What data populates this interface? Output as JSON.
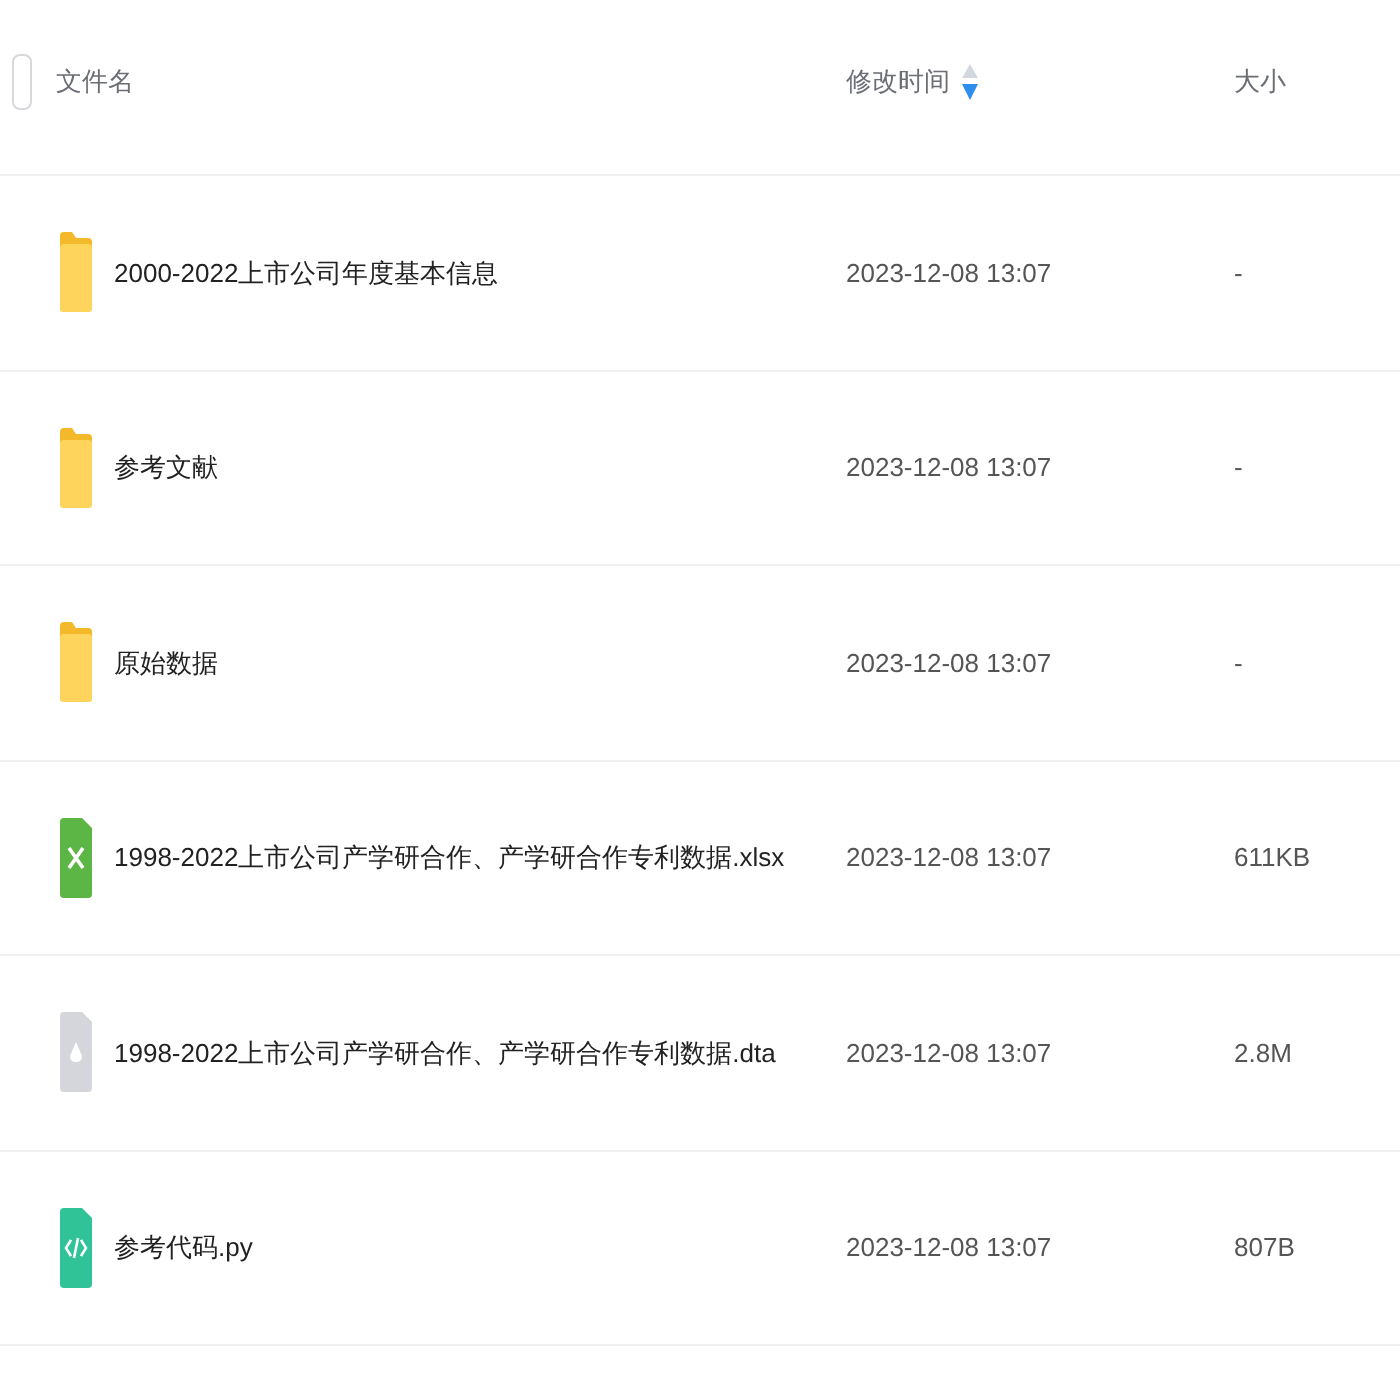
{
  "header": {
    "select_all": {
      "checked": false
    },
    "columns": [
      {
        "label": "文件名"
      },
      {
        "label": "修改时间",
        "sort_descending": true
      },
      {
        "label": "大小"
      }
    ]
  },
  "files": [
    {
      "kind": "folder",
      "name": "2000-2022上市公司年度基本信息",
      "modified": "2023-12-08 13:07",
      "size": "-"
    },
    {
      "kind": "folder",
      "name": "参考文献",
      "modified": "2023-12-08 13:07",
      "size": "-"
    },
    {
      "kind": "folder",
      "name": "原始数据",
      "modified": "2023-12-08 13:07",
      "size": "-"
    },
    {
      "kind": "spreadsheet",
      "name": "1998-2022上市公司产学研合作、产学研合作专利数据.xlsx",
      "modified": "2023-12-08 13:07",
      "size": "611KB"
    },
    {
      "kind": "data",
      "name": "1998-2022上市公司产学研合作、产学研合作专利数据.dta",
      "modified": "2023-12-08 13:07",
      "size": "2.8M"
    },
    {
      "kind": "code",
      "name": "参考代码.py",
      "modified": "2023-12-08 13:07",
      "size": "807B"
    }
  ]
}
